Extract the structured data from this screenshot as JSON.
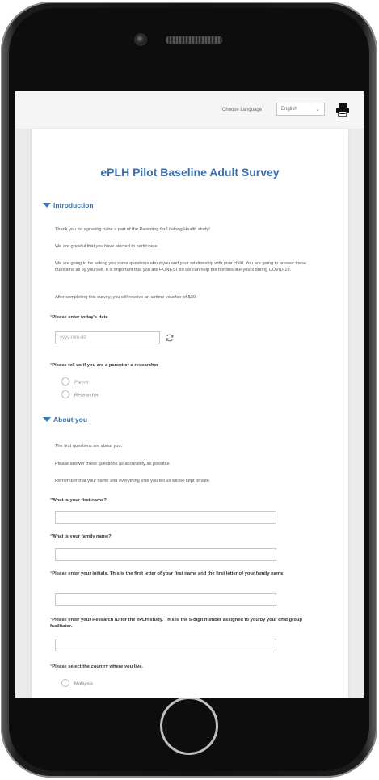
{
  "toolbar": {
    "language_label": "Choose Language",
    "language_value": "English"
  },
  "survey": {
    "title": "ePLH Pilot Baseline Adult Survey"
  },
  "introduction": {
    "heading": "Introduction",
    "paragraphs": [
      "Thank you for agreeing to be a part of the Parenting for Lifelong Health study!",
      "We are grateful that you have elected to participate.",
      "We are going to be asking you some questions about you and your relationship with your child. You are going to answer these questions all by yourself. It is important that you are HONEST so we can help the families like yours during COVID-19.",
      "After completing this survey, you will receive an airtime voucher of $30."
    ],
    "date_question": "Please enter today's date",
    "date_placeholder": "yyyy-mm-dd",
    "role_question": "Please tell us if you are a parent or a researcher",
    "role_options": [
      "Parent",
      "Researcher"
    ]
  },
  "about": {
    "heading": "About you",
    "paragraphs": [
      "The first questions are about you.",
      "Please answer these questions as accurately as possible.",
      "Remember that your name and everything else you tell us will be kept private."
    ],
    "q_first_name": "What is your first name?",
    "q_family_name": "What is your family name?",
    "q_initials": "Please enter your initials. This is the first letter of your first name and the first letter of your family name.",
    "q_research_id": "Please enter your Research ID for the ePLH study. This is the 5-digit number assigned to you by your chat group facilitator.",
    "q_country": "Please select the country where you live.",
    "country_options": [
      "Malaysia"
    ]
  },
  "colors": {
    "accent": "#3670ad",
    "required": "#c0392b"
  }
}
